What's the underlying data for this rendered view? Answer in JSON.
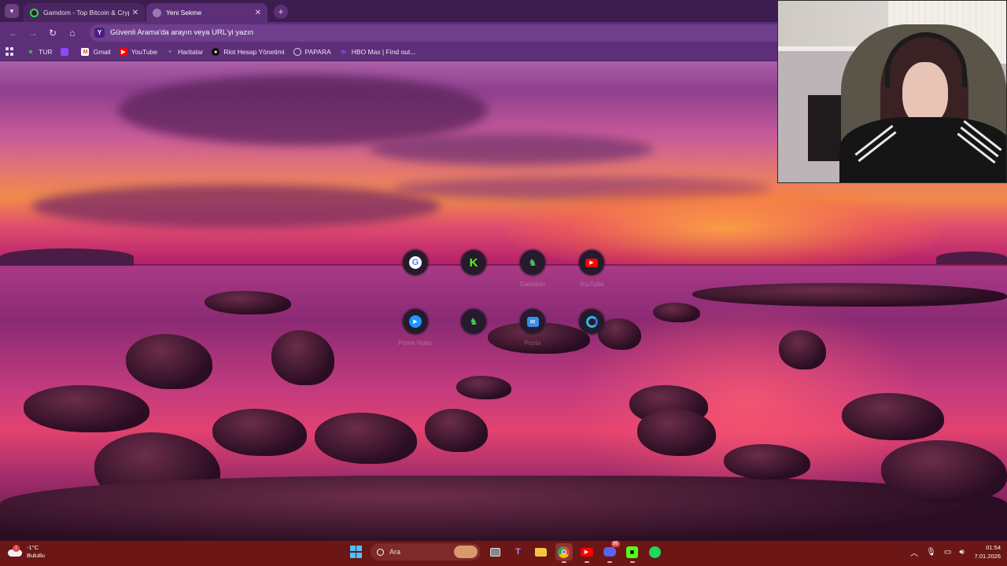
{
  "tabs": [
    {
      "title": "Gamdom - Top Bitcoin & Crypto",
      "active": false,
      "favicon": "gamdom-icon"
    },
    {
      "title": "Yeni Sekme",
      "active": true,
      "favicon": "new-tab-icon"
    }
  ],
  "toolbar": {
    "omnibox_placeholder": "Güvenli Arama'da arayın veya URL'yi yazın",
    "omnibox_icon_letter": "Y"
  },
  "bookmarks": [
    {
      "label": "TUR",
      "icon": "star-icon",
      "color": "#3ccf5a"
    },
    {
      "label": "",
      "icon": "twitch-icon",
      "color": "#9146ff"
    },
    {
      "label": "Gmail",
      "icon": "gmail-icon",
      "color": "#ea4335"
    },
    {
      "label": "YouTube",
      "icon": "youtube-icon",
      "color": "#ff0000"
    },
    {
      "label": "Haritalar",
      "icon": "maps-icon",
      "color": "#34a853"
    },
    {
      "label": "Riot Hesap Yönetimi",
      "icon": "riot-icon",
      "color": "#111111"
    },
    {
      "label": "PAPARA",
      "icon": "papara-icon",
      "color": "#dddddd"
    },
    {
      "label": "HBO Max | Find out...",
      "icon": "hbo-icon",
      "color": "#6b2bd9"
    }
  ],
  "shortcuts": [
    {
      "label": "",
      "icon": "google-icon"
    },
    {
      "label": "",
      "icon": "kick-icon"
    },
    {
      "label": "Gamdom",
      "icon": "gamdom-icon"
    },
    {
      "label": "YouTube",
      "icon": "youtube-icon"
    },
    {
      "label": "Prime Video",
      "icon": "prime-video-icon"
    },
    {
      "label": "",
      "icon": "gamdom-icon"
    },
    {
      "label": "Posta",
      "icon": "mail-icon"
    },
    {
      "label": "",
      "icon": "edge-icon"
    }
  ],
  "taskbar": {
    "weather_temp": "-1°C",
    "weather_desc": "Bulutlu",
    "search_placeholder": "Ara",
    "discord_badge": "99",
    "time": "01:54",
    "date": "7.01.2026"
  },
  "colors": {
    "tabstrip": "#3c1d4f",
    "toolbar": "#5d2f79",
    "taskbar": "#6c1616"
  }
}
